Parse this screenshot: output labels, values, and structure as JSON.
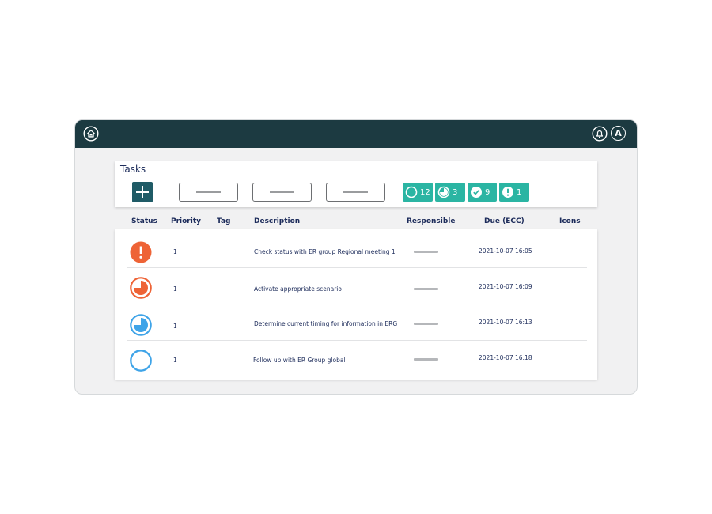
{
  "colors": {
    "topbar": "#1c3a41",
    "teal": "#2bb5a3",
    "add_button": "#1f5b66",
    "text": "#1c2b5a",
    "status_alert": "#ee6336",
    "status_progress_orange": "#ee6336",
    "status_progress_blue": "#3fa4e8",
    "status_open": "#3fa4e8"
  },
  "topbar": {
    "home_icon": "home-icon",
    "bell_icon": "bell-icon",
    "avatar_letter": "A"
  },
  "tasks": {
    "title": "Tasks",
    "stats": [
      {
        "icon": "circle-open-icon",
        "count": "12"
      },
      {
        "icon": "circle-progress-icon",
        "count": "3"
      },
      {
        "icon": "check-circle-icon",
        "count": "9"
      },
      {
        "icon": "exclamation-circle-icon",
        "count": "1"
      }
    ]
  },
  "table": {
    "headers": {
      "status": "Status",
      "priority": "Priority",
      "tag": "Tag",
      "description": "Description",
      "responsible": "Responsible",
      "due": "Due (ECC)",
      "icons": "Icons"
    },
    "rows": [
      {
        "status": "alert",
        "priority": "1",
        "description": "Check status with ER group Regional meeting 1",
        "due": "2021-10-07 16:05"
      },
      {
        "status": "in-progress-high",
        "priority": "1",
        "description": "Activate appropriate scenario",
        "due": "2021-10-07 16:09"
      },
      {
        "status": "in-progress",
        "priority": "1",
        "description": "Determine current timing for information in ERG",
        "due": "2021-10-07 16:13"
      },
      {
        "status": "open",
        "priority": "1",
        "description": "Follow up with ER Group global",
        "due": "2021-10-07 16:18"
      }
    ]
  }
}
